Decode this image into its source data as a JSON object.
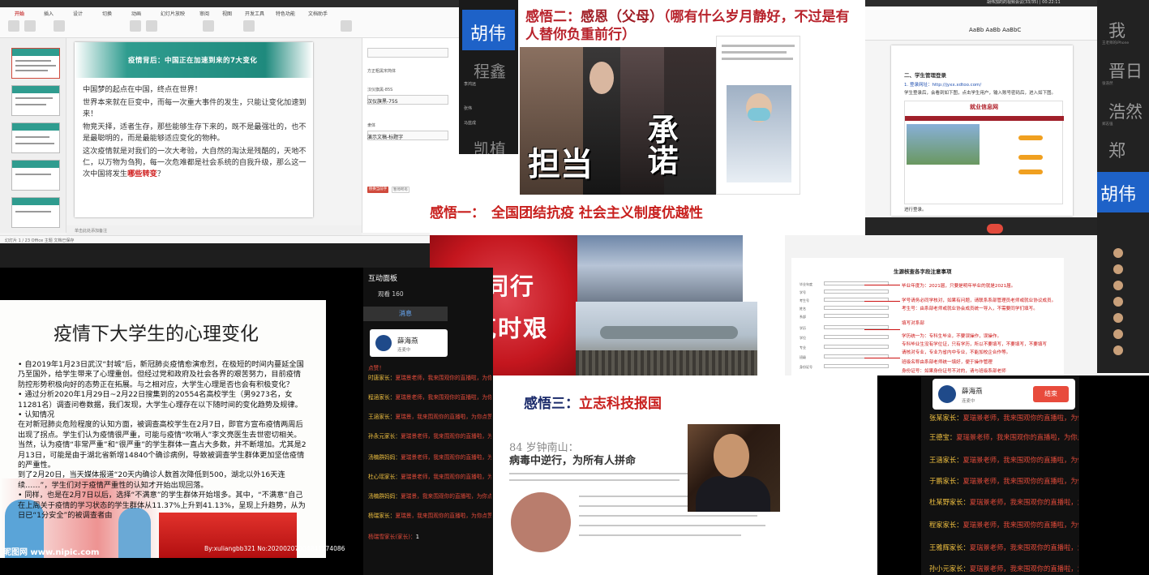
{
  "ppt_window": {
    "tabs": [
      "开始",
      "插入",
      "设计",
      "切换",
      "动画",
      "幻灯片放映",
      "审阅",
      "视图",
      "开发工具",
      "特色功能",
      "文档助手"
    ],
    "active_tab": "开始",
    "slide_title": "疫情背后：中国正在加速到来的7大变化",
    "slide_paragraphs": [
      "中国梦的起点在中国，终点在世界！",
      "世界本来就在巨变中，而每一次重大事件的发生，只能让变化加速到来！",
      "物竞天择，适者生存，那些能够生存下来的，既不是最强壮的，也不是最聪明的，而是最能够适应变化的物种。",
      "这次疫情就是对我们的一次大考验，大自然的淘汰是残酷的，天地不仁，以万物为刍狗，每一次危难都是社会系统的自我升级，那么这一次中国将发生"
    ],
    "slide_highlight": "哪些转变",
    "slide_end": "？",
    "panel_items": [
      "方正粗黑宋简体",
      "汉仪旗黑-85S",
      "汉仪旗黑-75S",
      "隶体",
      "演示文稿-标题字"
    ],
    "panel_buttons": [
      "替换当前字体",
      "暂停所有"
    ],
    "notes": "单击此处添加备注",
    "status": "幻灯片 1 / 23   Office 主题   文档已保存"
  },
  "participant_strip": {
    "big_name": "胡伟",
    "ghost_names": [
      "程鑫",
      "凯植"
    ],
    "labels": [
      "李鸿远",
      "张伟",
      "马蓝成"
    ]
  },
  "gratitude2": {
    "title_prefix": "感悟二：",
    "title_strong": "感恩（父母）",
    "title_rest": "（哪有什么岁月静好，不过是有人替你负重前行）",
    "captions": [
      "担当",
      "承诺"
    ]
  },
  "doc_window": {
    "title": "胡伟加的的视频会议(33/35) | 00:22:11",
    "heading": "二、学生管理登录",
    "line1": "1. 登录网址：http://jyxx.xdtoo.com/",
    "line2": "学生登录后，会看到如下图，点击学生用户，输入账号密码后，进入如下图。",
    "site": "就业信息网",
    "after": "进行登录。"
  },
  "right_column": {
    "names": [
      "我",
      "晋日",
      "浩然",
      "郑"
    ],
    "big_name": "胡伟",
    "labels": [
      "王老师的iPhone",
      "张浩然",
      "郑志强"
    ]
  },
  "gratitude1": {
    "title_prefix": "感悟一：",
    "title": "全国团结抗疫 社会主义制度优越性",
    "heart_text": [
      "风雨同行",
      "共克时艰"
    ]
  },
  "form": {
    "title": "生源核查各字段注意事项",
    "notes": [
      "毕业年度为：2021届，只要是明年毕业的就是2021届。",
      "学号请务必同学核对，如果有问题，请联系系部管理员老师或就业协议成员。",
      "考生号：由系部老师或就业协会成员统一导入，不需要同学们填写。",
      "填写对系部",
      "学历统一为：专科生毕业，不要误操作，误操作。",
      "专科毕业生没有学位证，只有学历，所以不要填写，不要填写，不要填写",
      "请核对专业，专业为省内中专业，不能加校企合作等。",
      "班级名称由系部老师统一填好，便于操作管理",
      "身份证号：如果身份证号不对的，请与班级系部老师"
    ]
  },
  "lecture": {
    "title": "疫情下大学生的心理变化",
    "paragraphs": [
      "• 自2019年1月23日武汉“封城”后，新冠肺炎疫情愈演愈烈，在极短的时间内蔓延全国乃至国外，给学生带来了心理重创。但经过党和政府及社会各界的艰苦努力，目前疫情防控形势积极向好的态势正在拓展。与之相对应，大学生心理是否也会有积极变化？",
      "• 通过分析2020年1月29日~2月22日搜集到的20554名高校学生（男9273名，女11281名）调查问卷数据，我们发现，大学生心理存在以下随时间的变化趋势及规律。",
      "• 认知情况",
      "  在对新冠肺炎危险程度的认知方面，被调查高校学生在2月7日，即官方宣布疫情两周后出现了拐点。学生们认为疫情很严重，可能与疫情“吹哨人”李文亮医生去世密切相关。",
      "  当然，认为疫情“非常严重”和“很严重”的学生群体一直占大多数，并不断增加。尤其是2月13日，可能是由于湖北省新增14840个确诊病例，导致被调查学生群体更加坚信疫情的严重性。",
      "  到了2月20日，当天媒体报道“20天内确诊人数首次降低到500，湖北以外16天连续……”，学生们对于疫情严重性的认知才开始出现回落。",
      "• 同样，也是在2月7日以后，选择“不满意”的学生群体开始增多。其中，“不满意”自己在上周关于疫情的学习状态的学生群体从11.37%上升到41.13%，呈现上升趋势，从为日已“1分安全”的被调查者由"
    ],
    "caption_left": "昵图网 www.nipic.com",
    "caption_right": "By:xuliangbb321 No:20200207004841274086"
  },
  "interaction": {
    "header": "互动面板",
    "viewers": "观看 160",
    "tab": "消息",
    "host_name": "薛海燕",
    "host_status": "连麦中",
    "messages": [
      {
        "name": "",
        "text": "点赞！"
      },
      {
        "name": "时唐家长：",
        "text": "夏瑞景老师，我来围观你的直播啦，为你点赞！"
      },
      {
        "name": "程涵家长：",
        "text": "夏瑞景老师，我来围观你的直播啦，为你点赞！"
      },
      {
        "name": "王涵家长：",
        "text": "夏瑞景，我来围观你的直播啦，为你点赞！"
      },
      {
        "name": "孙永元家长：",
        "text": "夏瑞景老师，我来围观你的直播啦，为你点赞！"
      },
      {
        "name": "汤楠群妈妈：",
        "text": "夏瑞景老师，我来围观你的直播啦，为你点赞！"
      },
      {
        "name": "杜心瑶家长：",
        "text": "夏瑞景老师，我来围观你的直播啦，为你点赞！"
      },
      {
        "name": "汤楠群妈妈：",
        "text": "夏瑞景，我来围观你的直播啦，为你点赞！"
      },
      {
        "name": "杨瑞家长：",
        "text": "夏瑞景，我来围观你的直播啦，为你点赞！"
      },
      {
        "name": "杨瑞雪家长(家长)：",
        "text": "1"
      }
    ]
  },
  "gratitude3": {
    "title_prefix": "感悟三：",
    "title": "立志科技报国",
    "news_h1": "84 岁钟南山：",
    "news_h2": "病毒中逆行，为所有人拼命"
  },
  "chat2": {
    "host_name": "薛海燕",
    "host_status": "连麦中",
    "end_button": "结束",
    "messages": [
      {
        "name": "张某家长：",
        "text": "夏瑞景老师，我来围观你的直播啦，为你点赞！"
      },
      {
        "name": "王德宝：",
        "text": "夏瑞景老师，我来围观你的直播啦，为你点赞！"
      },
      {
        "name": "王涵家长：",
        "text": "夏瑞景老师，我来围观你的直播啦，为你点赞！"
      },
      {
        "name": "于鹏家长：",
        "text": "夏瑞景老师，我来围观你的直播啦，为你点赞！"
      },
      {
        "name": "杜某野家长：",
        "text": "夏瑞景老师，我来围观你的直播啦，为你点赞！"
      },
      {
        "name": "程家家长：",
        "text": "夏瑞景老师，我来围观你的直播啦，为你点赞！"
      },
      {
        "name": "王雅辉家长：",
        "text": "夏瑞景老师，我来围观你的直播啦，为你点赞！"
      },
      {
        "name": "孙小元家长：",
        "text": "夏瑞景老师，我来围观你的直播啦，为你点赞！"
      }
    ]
  }
}
